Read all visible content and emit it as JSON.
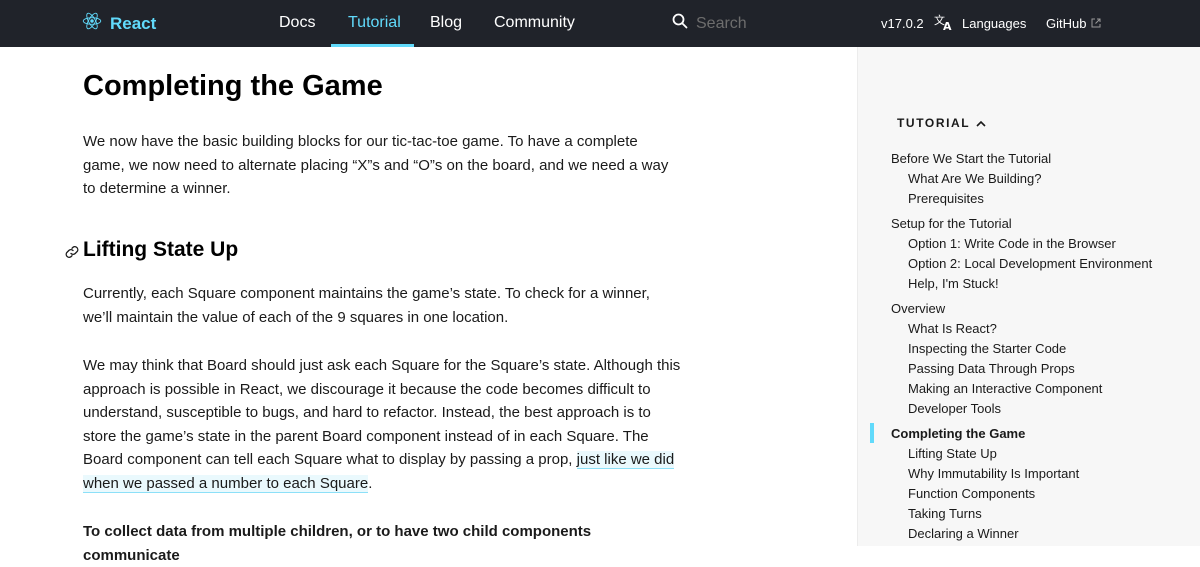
{
  "header": {
    "brand": "React",
    "nav": [
      "Docs",
      "Tutorial",
      "Blog",
      "Community"
    ],
    "active_nav": "Tutorial",
    "search_placeholder": "Search",
    "version": "v17.0.2",
    "languages": "Languages",
    "github": "GitHub",
    "accent_color": "#61dafb",
    "background_color": "#20232a"
  },
  "main": {
    "title": "Completing the Game",
    "intro": "We now have the basic building blocks for our tic-tac-toe game. To have a complete game, we now need to alternate placing “X”s and “O”s on the board, and we need a way to determine a winner.",
    "section_title": "Lifting State Up",
    "para1": "Currently, each Square component maintains the game’s state. To check for a winner, we’ll maintain the value of each of the 9 squares in one location.",
    "para2_text": "We may think that Board should just ask each Square for the Square’s state. Although this approach is possible in React, we discourage it because the code becomes difficult to understand, susceptible to bugs, and hard to refactor. Instead, the best approach is to store the game’s state in the parent Board component instead of in each Square. The Board component can tell each Square what to display by passing a prop, ",
    "para2_link": "just like we did when we passed a number to each Square",
    "para2_end": ".",
    "para3": "To collect data from multiple children, or to have two child components communicate"
  },
  "sidebar": {
    "header": "TUTORIAL",
    "items": [
      {
        "label": "Before We Start the Tutorial",
        "level": 0
      },
      {
        "label": "What Are We Building?",
        "level": 1
      },
      {
        "label": "Prerequisites",
        "level": 1
      },
      {
        "label": "Setup for the Tutorial",
        "level": 0
      },
      {
        "label": "Option 1: Write Code in the Browser",
        "level": 1
      },
      {
        "label": "Option 2: Local Development Environment",
        "level": 1
      },
      {
        "label": "Help, I'm Stuck!",
        "level": 1
      },
      {
        "label": "Overview",
        "level": 0
      },
      {
        "label": "What Is React?",
        "level": 1
      },
      {
        "label": "Inspecting the Starter Code",
        "level": 1
      },
      {
        "label": "Passing Data Through Props",
        "level": 1
      },
      {
        "label": "Making an Interactive Component",
        "level": 1
      },
      {
        "label": "Developer Tools",
        "level": 1
      },
      {
        "label": "Completing the Game",
        "level": 0,
        "active": true
      },
      {
        "label": "Lifting State Up",
        "level": 1
      },
      {
        "label": "Why Immutability Is Important",
        "level": 1
      },
      {
        "label": "Function Components",
        "level": 1
      },
      {
        "label": "Taking Turns",
        "level": 1
      },
      {
        "label": "Declaring a Winner",
        "level": 1
      }
    ]
  }
}
